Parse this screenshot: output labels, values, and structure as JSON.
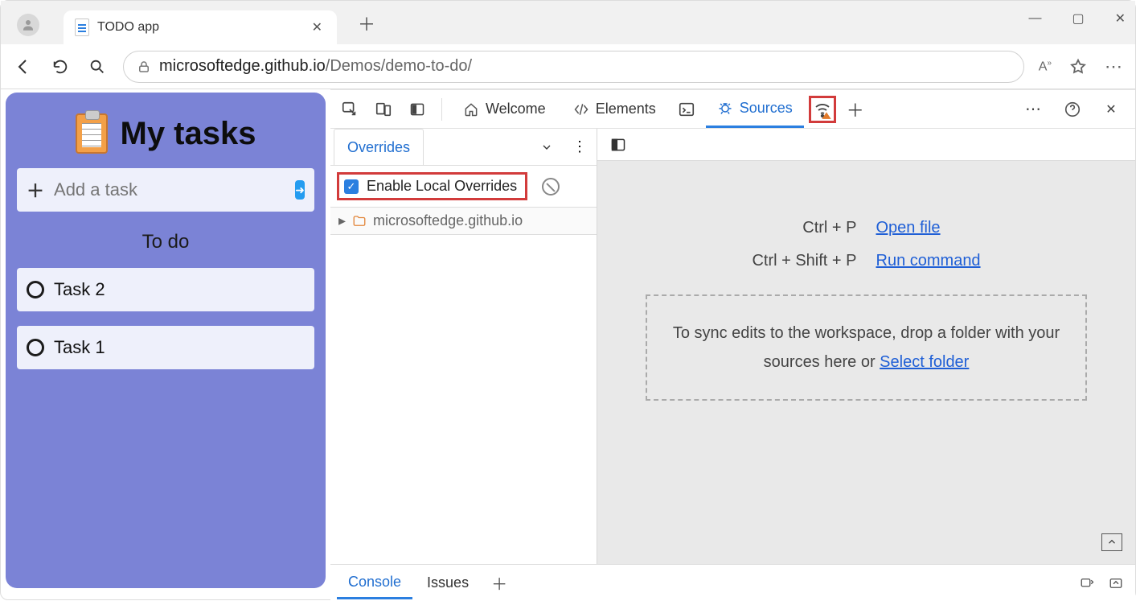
{
  "browser": {
    "tab_title": "TODO app",
    "url_host": "microsoftedge.github.io",
    "url_path": "/Demos/demo-to-do/"
  },
  "app": {
    "title": "My tasks",
    "add_placeholder": "Add a task",
    "section_label": "To do",
    "tasks": [
      {
        "label": "Task 2"
      },
      {
        "label": "Task 1"
      }
    ]
  },
  "devtools": {
    "tabs": {
      "welcome": "Welcome",
      "elements": "Elements",
      "sources": "Sources"
    },
    "overrides": {
      "tab_label": "Overrides",
      "enable_label": "Enable Local Overrides",
      "enable_checked": true,
      "tree_host": "microsoftedge.github.io"
    },
    "editor": {
      "hint_open_key": "Ctrl + P",
      "hint_open_label": "Open file",
      "hint_cmd_key": "Ctrl + Shift + P",
      "hint_cmd_label": "Run command",
      "dropzone_text": "To sync edits to the workspace, drop a folder with your sources here or ",
      "dropzone_link": "Select folder"
    },
    "drawer": {
      "console": "Console",
      "issues": "Issues"
    }
  }
}
